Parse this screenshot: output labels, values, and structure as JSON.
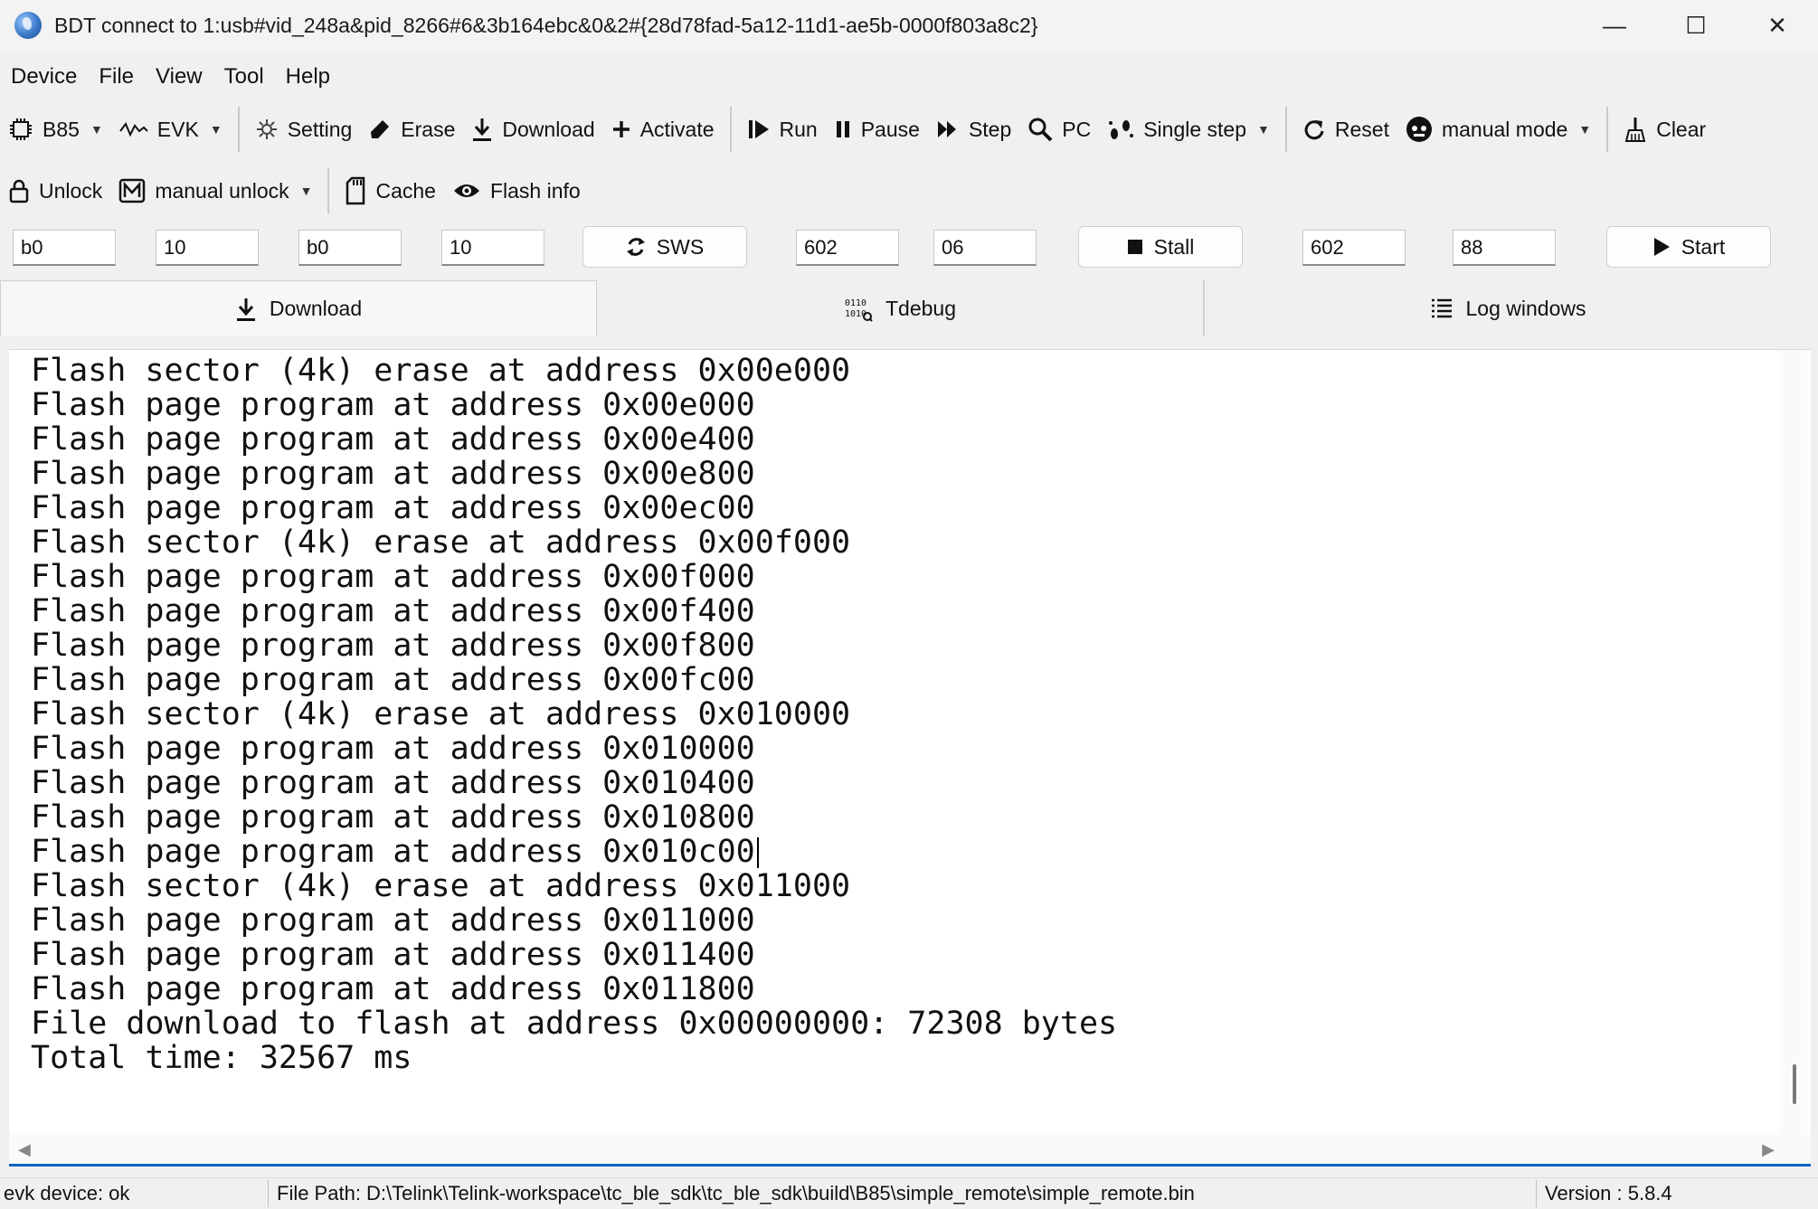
{
  "window": {
    "title": "BDT connect to 1:usb#vid_248a&pid_8266#6&3b164ebc&0&2#{28d78fad-5a12-11d1-ae5b-0000f803a8c2}",
    "controls": {
      "minimize": "—",
      "maximize": "☐",
      "close": "✕"
    }
  },
  "menu": [
    "Device",
    "File",
    "View",
    "Tool",
    "Help"
  ],
  "toolbar1": {
    "chip": "B85",
    "board": "EVK",
    "setting": "Setting",
    "erase": "Erase",
    "download": "Download",
    "activate": "Activate",
    "run": "Run",
    "pause": "Pause",
    "step": "Step",
    "pc": "PC",
    "single_step": "Single step",
    "reset": "Reset",
    "mode": "manual mode",
    "clear": "Clear"
  },
  "toolbar2": {
    "unlock": "Unlock",
    "manual_unlock": "manual unlock",
    "cache": "Cache",
    "flash_info": "Flash info"
  },
  "inputs": {
    "f1": "b0",
    "f2": "10",
    "f3": "b0",
    "f4": "10",
    "sws_label": "SWS",
    "f5": "602",
    "f6": "06",
    "stall_label": "Stall",
    "f7": "602",
    "f8": "88",
    "start_label": "Start"
  },
  "tabs": {
    "download": "Download",
    "tdebug": "Tdebug",
    "log": "Log windows"
  },
  "log": {
    "lines": [
      "Flash sector (4k) erase at address 0x00e000",
      "Flash page program at address 0x00e000",
      "Flash page program at address 0x00e400",
      "Flash page program at address 0x00e800",
      "Flash page program at address 0x00ec00",
      "Flash sector (4k) erase at address 0x00f000",
      "Flash page program at address 0x00f000",
      "Flash page program at address 0x00f400",
      "Flash page program at address 0x00f800",
      "Flash page program at address 0x00fc00",
      "Flash sector (4k) erase at address 0x010000",
      "Flash page program at address 0x010000",
      "Flash page program at address 0x010400",
      "Flash page program at address 0x010800",
      "Flash page program at address 0x010c00",
      "Flash sector (4k) erase at address 0x011000",
      "Flash page program at address 0x011000",
      "Flash page program at address 0x011400",
      "Flash page program at address 0x011800",
      "File download to flash at address 0x00000000: 72308 bytes",
      "Total time: 32567 ms"
    ]
  },
  "status": {
    "device": "evk device: ok",
    "file_path": "File Path:  D:\\Telink\\Telink-workspace\\tc_ble_sdk\\tc_ble_sdk\\build\\B85\\simple_remote\\simple_remote.bin",
    "version": "Version : 5.8.4"
  }
}
